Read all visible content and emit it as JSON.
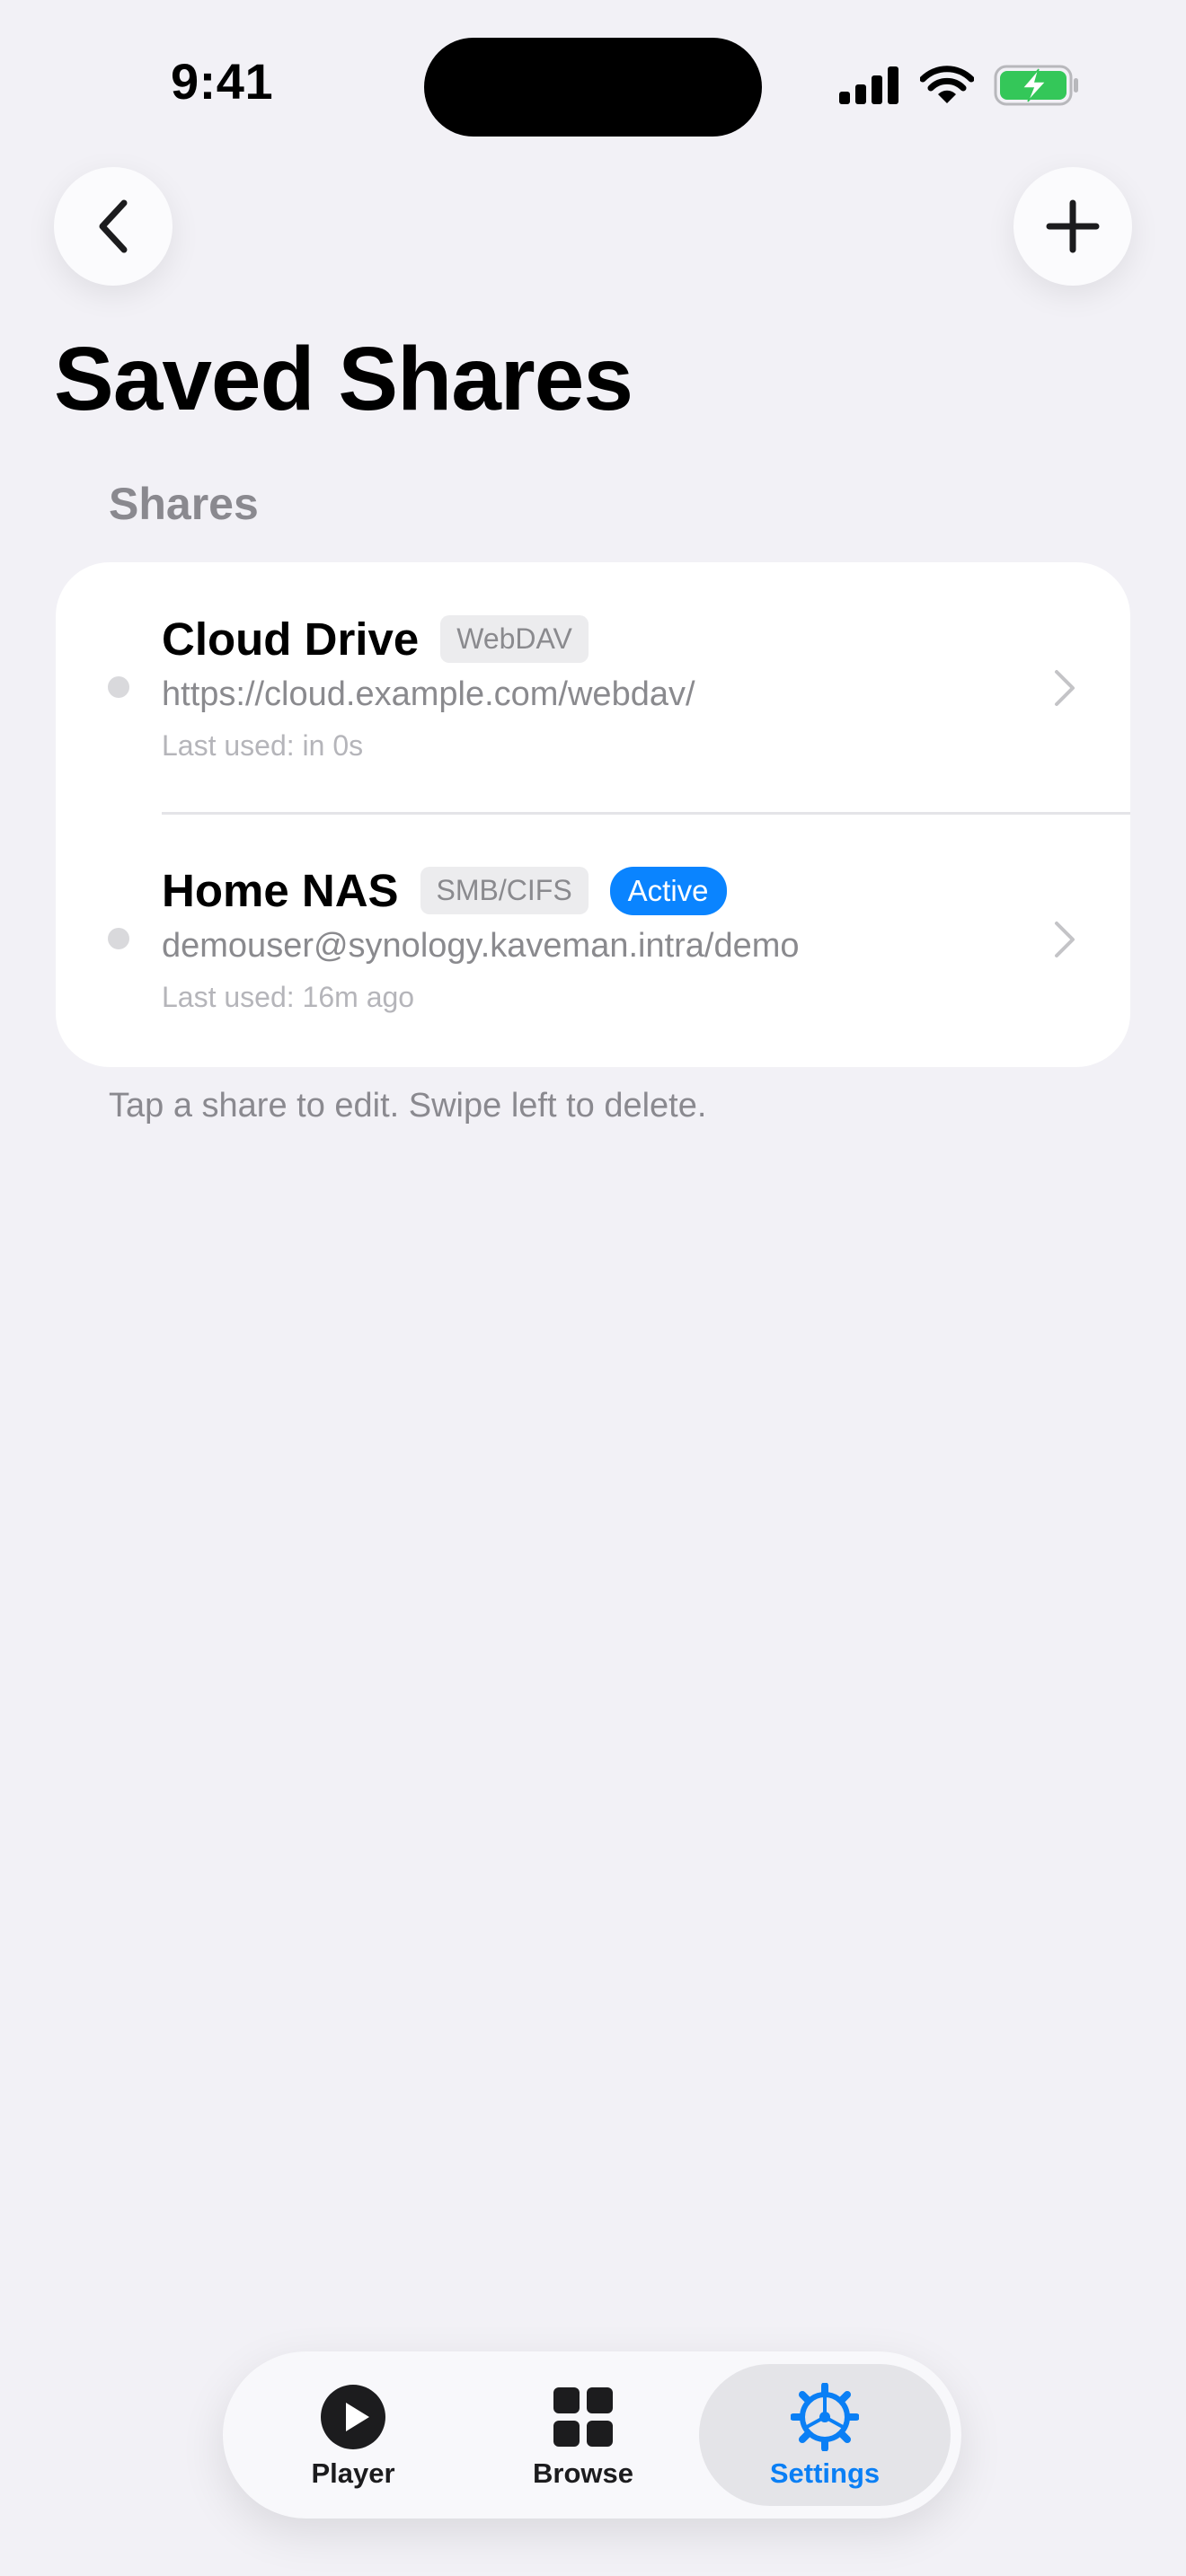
{
  "status_bar": {
    "time": "9:41",
    "icons": [
      "cellular-signal-icon",
      "wifi-icon",
      "battery-charging-icon"
    ],
    "battery_color": "#34c759"
  },
  "nav": {
    "back_icon": "chevron-left-icon",
    "add_icon": "plus-icon"
  },
  "page": {
    "title": "Saved Shares"
  },
  "shares_section": {
    "header": "Shares",
    "footer": "Tap a share to edit. Swipe left to delete.",
    "items": [
      {
        "name": "Cloud Drive",
        "protocol": "WebDAV",
        "active_label": "",
        "url": "https://cloud.example.com/webdav/",
        "last_used": "Last used: in 0s"
      },
      {
        "name": "Home NAS",
        "protocol": "SMB/CIFS",
        "active_label": "Active",
        "url": "demouser@synology.kaveman.intra/demo",
        "last_used": "Last used: 16m ago"
      }
    ]
  },
  "tab_bar": {
    "accent_color": "#0a7ff5",
    "selected": "Settings",
    "tabs": [
      {
        "label": "Player",
        "icon": "play-circle-icon"
      },
      {
        "label": "Browse",
        "icon": "grid-icon"
      },
      {
        "label": "Settings",
        "icon": "gear-icon"
      }
    ]
  }
}
